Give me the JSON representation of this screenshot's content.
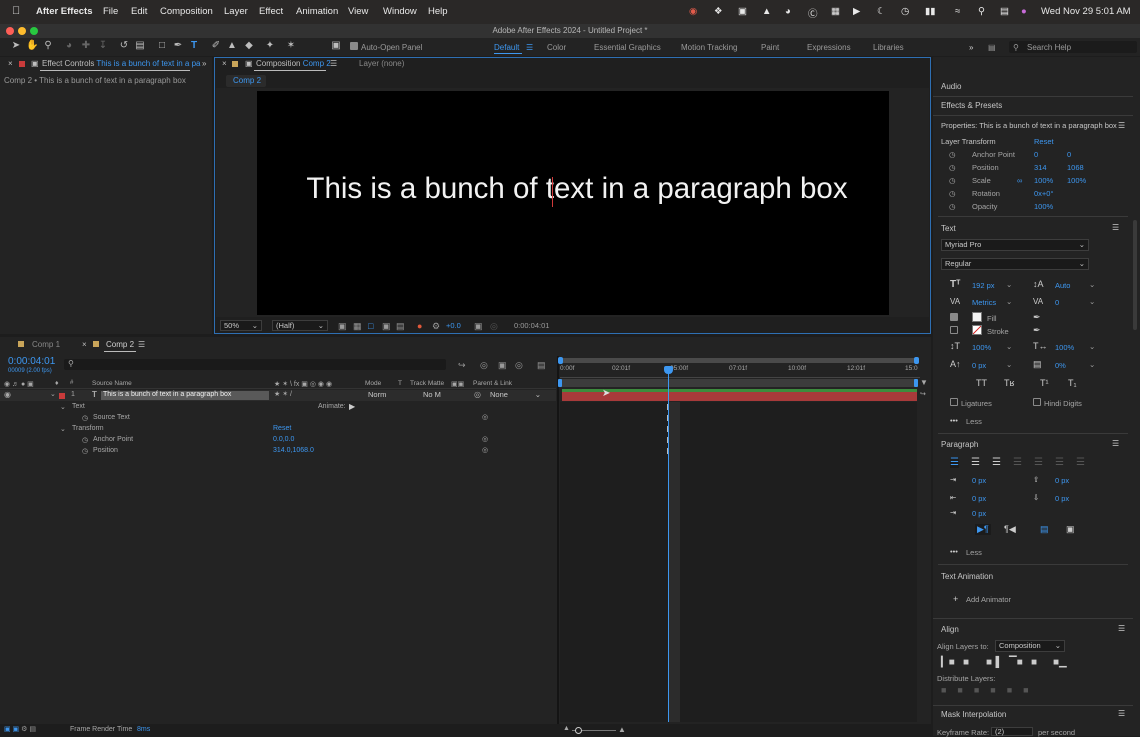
{
  "menubar": {
    "app_name": "After Effects",
    "items": [
      "File",
      "Edit",
      "Composition",
      "Layer",
      "Effect",
      "Animation",
      "View",
      "Window",
      "Help"
    ],
    "clock": "Wed Nov 29  5:01 AM"
  },
  "window_title": "Adobe After Effects 2024 - Untitled Project *",
  "toolbar": {
    "auto_open_label": "Auto-Open Panel",
    "workspaces": [
      "Default",
      "Color",
      "Essential Graphics",
      "Motion Tracking",
      "Paint",
      "Expressions",
      "Libraries"
    ],
    "search_placeholder": "Search Help"
  },
  "effect_controls": {
    "tab_label": "Effect Controls",
    "tab_target": "This is a bunch of text in a pa",
    "breadcrumb": "Comp 2 • This is a bunch of text in a paragraph box"
  },
  "composition_panel": {
    "tab_label": "Composition",
    "tab_target": "Comp 2",
    "layer_tab": "Layer (none)",
    "sub_tab": "Comp 2",
    "canvas_text": "This is a bunch of text in a paragraph box",
    "zoom": "50%",
    "resolution": "(Half)",
    "exposure": "+0.0",
    "timecode": "0:00:04:01"
  },
  "timeline": {
    "tabs": [
      "Comp 1",
      "Comp 2"
    ],
    "timecode": "0:00:04:01",
    "frame_info": "00009 (2.00 fps)",
    "search_placeholder": "",
    "columns": {
      "source_name": "Source Name",
      "mode": "Mode",
      "t": "T",
      "track_matte": "Track Matte",
      "parent": "Parent & Link"
    },
    "layer": {
      "number": "1",
      "name": "This is a bunch of text in a paragraph box",
      "mode": "Norm",
      "matte": "No M",
      "parent": "None"
    },
    "rows": {
      "text": "Text",
      "animate": "Animate:",
      "source_text": "Source Text",
      "transform": "Transform",
      "reset": "Reset",
      "anchor_point": "Anchor Point",
      "anchor_value": "0.0,0.0",
      "position": "Position",
      "position_value": "314.0,1068.0"
    },
    "ruler_ticks": [
      "0:00f",
      "02:01f",
      "05:00f",
      "07:01f",
      "10:00f",
      "12:01f",
      "15:0"
    ],
    "frame_render_time_label": "Frame Render Time",
    "frame_render_time_value": "8ms"
  },
  "right_panel": {
    "audio": "Audio",
    "effects_presets": "Effects & Presets",
    "properties_title": "Properties: This is a bunch of text in a paragraph box",
    "layer_transform": "Layer Transform",
    "reset": "Reset",
    "anchor_label": "Anchor Point",
    "anchor_x": "0",
    "anchor_y": "0",
    "position_label": "Position",
    "position_x": "314",
    "position_y": "1068",
    "scale_label": "Scale",
    "scale_x": "100%",
    "scale_y": "100%",
    "rotation_label": "Rotation",
    "rotation_value": "0x+0°",
    "opacity_label": "Opacity",
    "opacity_value": "100%",
    "text_section": "Text",
    "font": "Myriad Pro",
    "style": "Regular",
    "font_size": "192 px",
    "leading": "Auto",
    "kerning": "Metrics",
    "tracking": "0",
    "fill": "Fill",
    "stroke": "Stroke",
    "vscale": "100%",
    "hscale": "100%",
    "baseline": "0 px",
    "tsume": "0%",
    "ligatures": "Ligatures",
    "hindi_digits": "Hindi Digits",
    "less": "Less",
    "paragraph_section": "Paragraph",
    "indent_left": "0 px",
    "space_before": "0 px",
    "indent_first": "0 px",
    "space_after": "0 px",
    "indent_right": "0 px",
    "text_animation": "Text Animation",
    "add_animator": "Add Animator",
    "align_section": "Align",
    "align_to_label": "Align Layers to:",
    "align_to_value": "Composition",
    "distribute": "Distribute Layers:",
    "mask_interp": "Mask Interpolation",
    "keyframe_rate_label": "Keyframe Rate:",
    "keyframe_rate_value": "(2)",
    "per_second": "per second"
  }
}
